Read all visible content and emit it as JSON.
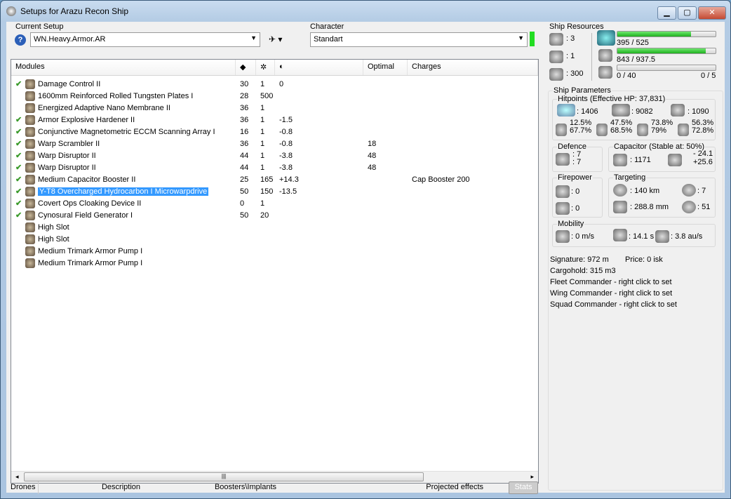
{
  "window": {
    "title": "Setups for Arazu Recon Ship",
    "min": "▁",
    "max": "▢",
    "close": "✕"
  },
  "setup": {
    "label": "Current Setup",
    "value": "WN.Heavy.Armor.AR",
    "help": "?"
  },
  "character": {
    "label": "Character",
    "value": "Standart",
    "status_color": "#22dd22"
  },
  "columns": [
    "Modules",
    "",
    "",
    "",
    "Optimal",
    "Charges"
  ],
  "modules": [
    {
      "checked": true,
      "name": "Damage Control II",
      "a": "30",
      "b": "1",
      "c": "0",
      "opt": "",
      "charge": ""
    },
    {
      "checked": false,
      "name": "1600mm Reinforced Rolled Tungsten Plates I",
      "a": "28",
      "b": "500",
      "c": "",
      "opt": "",
      "charge": ""
    },
    {
      "checked": false,
      "name": "Energized Adaptive Nano Membrane II",
      "a": "36",
      "b": "1",
      "c": "",
      "opt": "",
      "charge": ""
    },
    {
      "checked": true,
      "name": "Armor Explosive Hardener II",
      "a": "36",
      "b": "1",
      "c": "-1.5",
      "opt": "",
      "charge": ""
    },
    {
      "checked": true,
      "name": "Conjunctive Magnetometric ECCM Scanning Array I",
      "a": "16",
      "b": "1",
      "c": "-0.8",
      "opt": "",
      "charge": ""
    },
    {
      "checked": true,
      "name": "Warp Scrambler II",
      "a": "36",
      "b": "1",
      "c": "-0.8",
      "opt": "18",
      "charge": ""
    },
    {
      "checked": true,
      "name": "Warp Disruptor II",
      "a": "44",
      "b": "1",
      "c": "-3.8",
      "opt": "48",
      "charge": ""
    },
    {
      "checked": true,
      "name": "Warp Disruptor II",
      "a": "44",
      "b": "1",
      "c": "-3.8",
      "opt": "48",
      "charge": ""
    },
    {
      "checked": true,
      "name": "Medium Capacitor Booster II",
      "a": "25",
      "b": "165",
      "c": "+14.3",
      "opt": "",
      "charge": "Cap Booster 200"
    },
    {
      "checked": true,
      "name": "Y-T8 Overcharged Hydrocarbon I Microwarpdrive",
      "a": "50",
      "b": "150",
      "c": "-13.5",
      "opt": "",
      "charge": "",
      "selected": true
    },
    {
      "checked": true,
      "name": "Covert Ops Cloaking Device II",
      "a": "0",
      "b": "1",
      "c": "",
      "opt": "",
      "charge": ""
    },
    {
      "checked": true,
      "name": "Cynosural Field Generator I",
      "a": "50",
      "b": "20",
      "c": "",
      "opt": "",
      "charge": ""
    },
    {
      "checked": false,
      "name": "High Slot",
      "a": "",
      "b": "",
      "c": "",
      "opt": "",
      "charge": ""
    },
    {
      "checked": false,
      "name": "High Slot",
      "a": "",
      "b": "",
      "c": "",
      "opt": "",
      "charge": ""
    },
    {
      "checked": false,
      "name": "Medium Trimark Armor Pump I",
      "a": "",
      "b": "",
      "c": "",
      "opt": "",
      "charge": ""
    },
    {
      "checked": false,
      "name": "Medium Trimark Armor Pump I",
      "a": "",
      "b": "",
      "c": "",
      "opt": "",
      "charge": ""
    }
  ],
  "tabs": [
    "Drones",
    "Description",
    "Boosters\\Implants",
    "Projected effects"
  ],
  "stats_button": "Stats",
  "resources": {
    "label": "Ship Resources",
    "turrets": ": 3",
    "launchers": ": 1",
    "drone_bay": ": 300",
    "cpu": "395 / 525",
    "cpu_frac": 0.752,
    "power": "843 / 937.5",
    "power_frac": 0.9,
    "calib": "0 / 40",
    "calib_frac": 0,
    "rigs": "0 / 5"
  },
  "params": {
    "label": "Ship Parameters",
    "hp_label": "Hitpoints (Effective HP: 37,831)",
    "shield": ": 1406",
    "armor": ": 9082",
    "hull": ": 1090",
    "res": [
      [
        "12.5%",
        "67.7%"
      ],
      [
        "47.5%",
        "68.5%"
      ],
      [
        "73.8%",
        "79%"
      ],
      [
        "56.3%",
        "72.8%"
      ]
    ],
    "defence_label": "Defence",
    "def1": ": 7",
    "def2": ": 7",
    "cap_label": "Capacitor (Stable at: 50%)",
    "cap": ": 1171",
    "cap_use": "- 24.1",
    "cap_gain": "+25.6",
    "fire_label": "Firepower",
    "dps": ": 0",
    "volley": ": 0",
    "target_label": "Targeting",
    "range": ": 140 km",
    "targets": ": 7",
    "scan": ": 288.8 mm",
    "sensor": ": 51",
    "mob_label": "Mobility",
    "speed": ": 0 m/s",
    "align": ": 14.1 s",
    "warp": ": 3.8 au/s"
  },
  "info": {
    "signature": "Signature: 972 m",
    "price": "Price: 0 isk",
    "cargo": "Cargohold: 315 m3",
    "fleet": "Fleet Commander - right click to set",
    "wing": "Wing Commander - right click to set",
    "squad": "Squad Commander - right click to set"
  }
}
